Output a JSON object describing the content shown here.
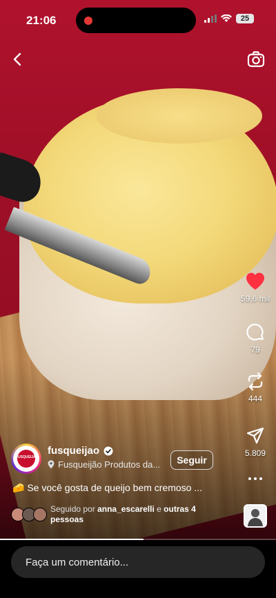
{
  "status_bar": {
    "time": "21:06",
    "battery": "25"
  },
  "reel": {
    "author": {
      "username": "fusqueijao",
      "avatar_text": "FUSQUEIJÃO",
      "location": "Fusqueijão Produtos da..."
    },
    "follow_label": "Seguir",
    "caption": "🧀 Se você gosta de queijo bem cremoso ...",
    "followed_by": {
      "prefix": "Seguido por",
      "user": "anna_escarelli",
      "middle": "e",
      "others": "outras 4 pessoas"
    },
    "actions": {
      "likes": "59,6 mil",
      "comments": "79",
      "reposts": "444",
      "shares": "5.809"
    },
    "liked": true,
    "progress": 0.52
  },
  "comment_input": {
    "placeholder": "Faça um comentário..."
  },
  "colors": {
    "like_red": "#ff3040",
    "background_red": "#b0122d",
    "comment_field": "#262626"
  },
  "icons": [
    "back-icon",
    "camera-icon",
    "heart-icon",
    "comment-icon",
    "repost-icon",
    "share-icon",
    "more-icon",
    "verified-icon",
    "location-icon"
  ]
}
